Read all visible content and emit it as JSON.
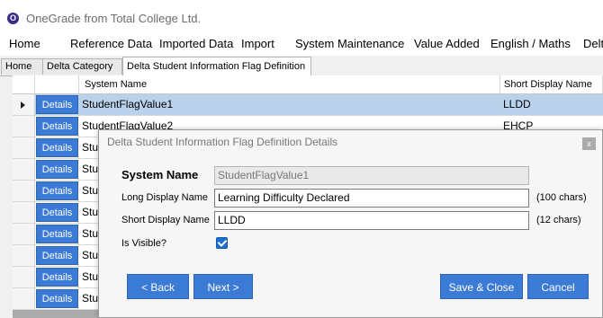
{
  "app": {
    "logo_letter": "O",
    "title": "OneGrade from Total College Ltd."
  },
  "menu": [
    "Home",
    "Reference Data",
    "Imported Data",
    "Import",
    "System Maintenance",
    "Value Added",
    "English / Maths",
    "Delta"
  ],
  "tabs": [
    "Home",
    "Delta Category",
    "Delta Student Information Flag Definition"
  ],
  "grid": {
    "columns": [
      "System Name",
      "Short Display Name"
    ],
    "details_label": "Details",
    "rows": [
      {
        "system_name": "StudentFlagValue1",
        "short_display": "LLDD"
      },
      {
        "system_name": "StudentFlagValue2",
        "short_display": "EHCP"
      },
      {
        "system_name": "Stu",
        "short_display": ""
      },
      {
        "system_name": "Stu",
        "short_display": ""
      },
      {
        "system_name": "Stu",
        "short_display": ""
      },
      {
        "system_name": "Stu",
        "short_display": ""
      },
      {
        "system_name": "Stu",
        "short_display": ""
      },
      {
        "system_name": "Stu",
        "short_display": ""
      },
      {
        "system_name": "Stu",
        "short_display": ""
      },
      {
        "system_name": "Stu",
        "short_display": ""
      }
    ]
  },
  "dialog": {
    "title": "Delta Student Information Flag Definition Details",
    "close_label": "x",
    "system_name_label": "System Name",
    "system_name_value": "StudentFlagValue1",
    "long_display_label": "Long Display Name",
    "long_display_value": "Learning Difficulty Declared",
    "long_display_limit": "(100 chars)",
    "short_display_label": "Short Display Name",
    "short_display_value": "LLDD",
    "short_display_limit": "(12 chars)",
    "visible_label": "Is Visible?",
    "visible_checked": true,
    "back_label": "< Back",
    "next_label": "Next >",
    "save_close_label": "Save & Close",
    "cancel_label": "Cancel"
  },
  "colors": {
    "accent": "#3b7bd6",
    "selected_row": "#b9d1ea",
    "logo": "#3a2b8c"
  }
}
